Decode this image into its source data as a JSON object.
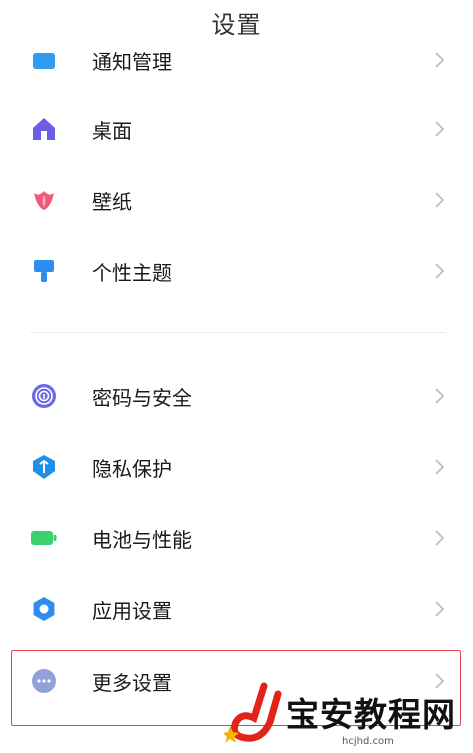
{
  "header": {
    "title": "设置"
  },
  "items": [
    {
      "label": "通知管理",
      "icon": "notification-icon",
      "color": "#2f9bf0"
    },
    {
      "label": "桌面",
      "icon": "home-icon",
      "color": "#6b5de6"
    },
    {
      "label": "壁纸",
      "icon": "tulip-icon",
      "color": "#f05a78"
    },
    {
      "label": "个性主题",
      "icon": "paintbrush-icon",
      "color": "#2f8cf0"
    },
    {
      "label": "密码与安全",
      "icon": "fingerprint-icon",
      "color": "#6a6ae8"
    },
    {
      "label": "隐私保护",
      "icon": "shield-icon",
      "color": "#1e90e8"
    },
    {
      "label": "电池与性能",
      "icon": "battery-icon",
      "color": "#3ccf6e"
    },
    {
      "label": "应用设置",
      "icon": "gear-icon",
      "color": "#2f8cf0"
    },
    {
      "label": "更多设置",
      "icon": "more-icon",
      "color": "#8fa2dc"
    }
  ],
  "watermark": {
    "text": "宝安教程网",
    "domain": "hcjhd.com",
    "logo_color": "#e2231a"
  }
}
